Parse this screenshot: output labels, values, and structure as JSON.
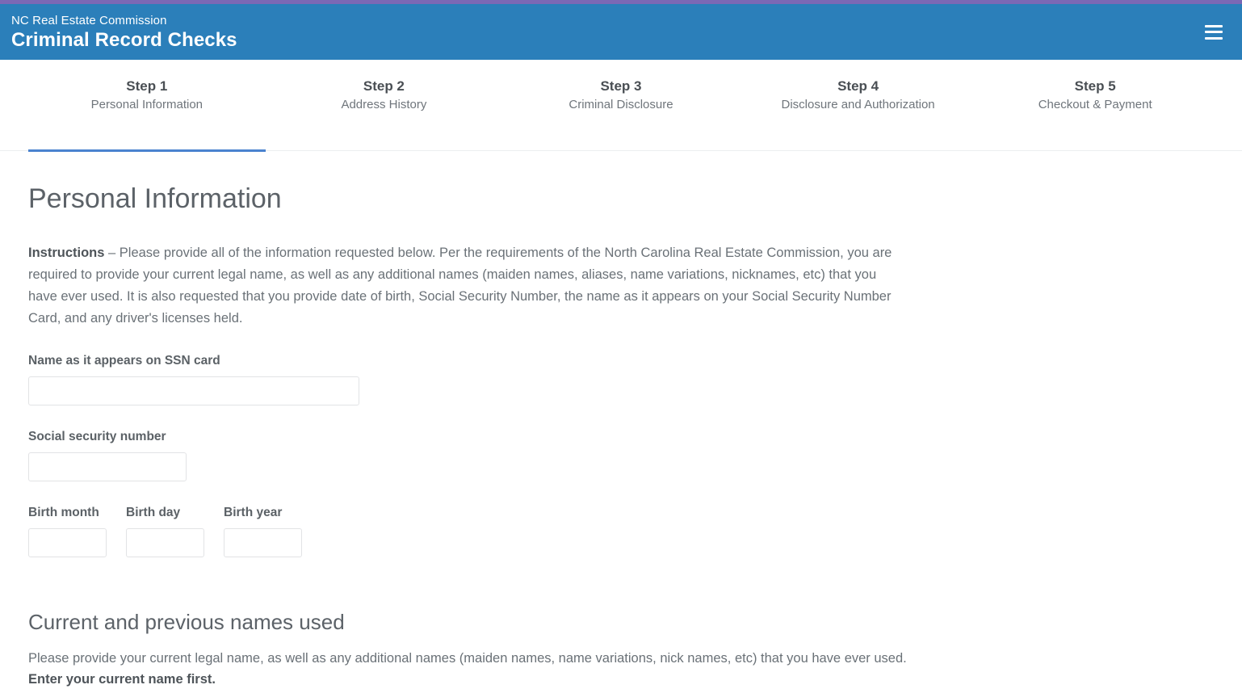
{
  "header": {
    "org": "NC Real Estate Commission",
    "title": "Criminal Record Checks",
    "menu_icon": "hamburger-menu-icon",
    "bg_color": "#2b7fba",
    "accent_strip_color": "#7b68b5"
  },
  "steps": [
    {
      "title": "Step 1",
      "subtitle": "Personal Information",
      "active": true
    },
    {
      "title": "Step 2",
      "subtitle": "Address History",
      "active": false
    },
    {
      "title": "Step 3",
      "subtitle": "Criminal Disclosure",
      "active": false
    },
    {
      "title": "Step 4",
      "subtitle": "Disclosure and Authorization",
      "active": false
    },
    {
      "title": "Step 5",
      "subtitle": "Checkout & Payment",
      "active": false
    }
  ],
  "active_step_underline_color": "#4a83cf",
  "main": {
    "page_title": "Personal Information",
    "instructions": {
      "lead": "Instructions",
      "body": " – Please provide all of the information requested below. Per the requirements of the North Carolina Real Estate Commission, you are required to provide your current legal name, as well as any additional names (maiden names, aliases, name variations, nicknames, etc) that you have ever used. It is also requested that you provide date of birth, Social Security Number, the name as it appears on your Social Security Number Card, and any driver's licenses held."
    },
    "fields": {
      "ssn_name": {
        "label": "Name as it appears on SSN card",
        "value": "",
        "placeholder": ""
      },
      "ssn": {
        "label": "Social security number",
        "value": "",
        "placeholder": ""
      },
      "birth_month": {
        "label": "Birth month",
        "value": "",
        "placeholder": ""
      },
      "birth_day": {
        "label": "Birth day",
        "value": "",
        "placeholder": ""
      },
      "birth_year": {
        "label": "Birth year",
        "value": "",
        "placeholder": ""
      }
    },
    "names_section": {
      "title": "Current and previous names used",
      "body": "Please provide your current legal name, as well as any additional names (maiden names, name variations, nick names, etc) that you have ever used. ",
      "emphasis": "Enter your current name first."
    }
  }
}
